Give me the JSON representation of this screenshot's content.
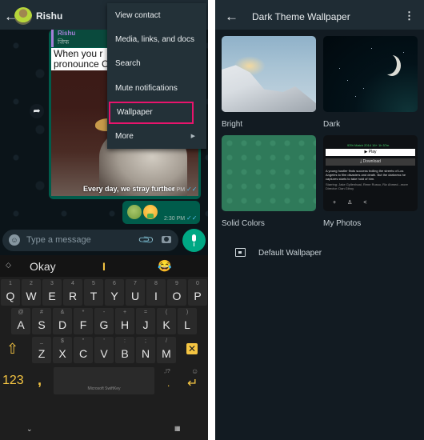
{
  "left": {
    "header": {
      "back_icon": "arrow-left-icon",
      "contact_name": "Rishu"
    },
    "chat": {
      "quoted": {
        "author": "Rishu",
        "text": "जिफ"
      },
      "gif_caption_text": [
        "When you r",
        "pronounce C"
      ],
      "gif_overlay_caption": "Every day, we stray further",
      "gif_time": "2:30 PM",
      "emoji_message": {
        "time": "2:30 PM"
      },
      "forward_icon": "forward-icon"
    },
    "menu": {
      "items": [
        {
          "label": "View contact"
        },
        {
          "label": "Media, links, and docs"
        },
        {
          "label": "Search"
        },
        {
          "label": "Mute notifications"
        },
        {
          "label": "Wallpaper",
          "highlighted": true
        },
        {
          "label": "More",
          "submenu": true
        }
      ],
      "highlight_color": "#e8146c"
    },
    "input": {
      "placeholder": "Type a message"
    },
    "keyboard": {
      "suggestions": [
        "Okay",
        "I",
        "😂"
      ],
      "row1": [
        {
          "k": "Q",
          "a": "1"
        },
        {
          "k": "W",
          "a": "2"
        },
        {
          "k": "E",
          "a": "3"
        },
        {
          "k": "R",
          "a": "4"
        },
        {
          "k": "T",
          "a": "5"
        },
        {
          "k": "Y",
          "a": "6"
        },
        {
          "k": "U",
          "a": "7"
        },
        {
          "k": "I",
          "a": "8"
        },
        {
          "k": "O",
          "a": "9"
        },
        {
          "k": "P",
          "a": "0"
        }
      ],
      "row2": [
        {
          "k": "A",
          "a": "@"
        },
        {
          "k": "S",
          "a": "#"
        },
        {
          "k": "D",
          "a": "&"
        },
        {
          "k": "F",
          "a": "*"
        },
        {
          "k": "G",
          "a": "-"
        },
        {
          "k": "H",
          "a": "+"
        },
        {
          "k": "J",
          "a": "="
        },
        {
          "k": "K",
          "a": "("
        },
        {
          "k": "L",
          "a": ")"
        }
      ],
      "row3": [
        {
          "k": "Z",
          "a": "_"
        },
        {
          "k": "X",
          "a": "$"
        },
        {
          "k": "C",
          "a": "\""
        },
        {
          "k": "V",
          "a": "'"
        },
        {
          "k": "B",
          "a": ":"
        },
        {
          "k": "N",
          "a": ";"
        },
        {
          "k": "M",
          "a": "/"
        }
      ],
      "numbers_label": "123",
      "comma": ",",
      "period": ".",
      "punct_hint": ",!?",
      "space_label": "Microsoft SwiftKey",
      "accent_color": "#f5c542"
    }
  },
  "right": {
    "header": {
      "title": "Dark Theme Wallpaper"
    },
    "tiles": [
      {
        "label": "Bright"
      },
      {
        "label": "Dark"
      },
      {
        "label": "Solid Colors"
      },
      {
        "label": "My Photos"
      }
    ],
    "my_photos_preview": {
      "match": "93% Match  2014  16+  1h 57m",
      "play": "▶ Play",
      "download": "⤓ Download",
      "description": "A young hustler finds success trolling the streets of Los Angeles to film disasters and death. But the darkness he captures starts to take hold of him.",
      "credits": "Starring: Jake Gyllenhaal, Rene Russo, Riz Ahmed...more  Director: Dan Gilroy"
    },
    "default_wallpaper": {
      "label": "Default Wallpaper"
    }
  }
}
